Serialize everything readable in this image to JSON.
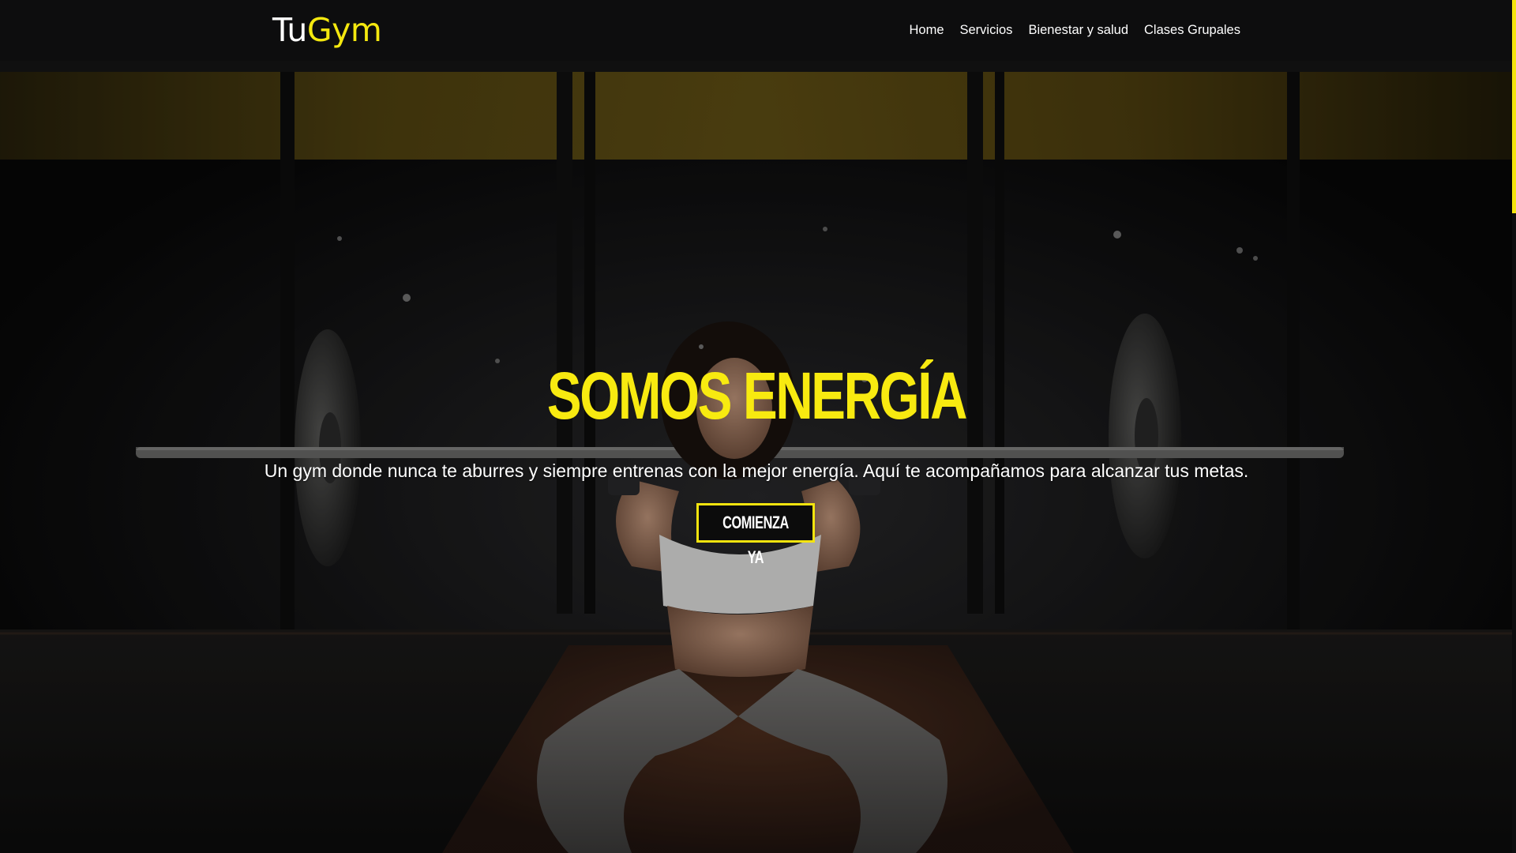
{
  "brand": {
    "part1": "Tu",
    "part2": "Gym"
  },
  "nav": {
    "items": [
      {
        "label": "Home"
      },
      {
        "label": "Servicios"
      },
      {
        "label": "Bienestar y salud"
      },
      {
        "label": "Clases Grupales"
      }
    ]
  },
  "hero": {
    "title": "SOMOS ENERGÍA",
    "subtitle": "Un gym donde nunca te aburres y siempre entrenas con la mejor energía. Aquí te acompañamos para alcanzar tus metas.",
    "cta_label": "COMIENZA YA"
  },
  "colors": {
    "accent": "#f4e80f",
    "navbar_bg": "#0d0d0e",
    "text": "#ffffff"
  },
  "icons": {
    "background": "gym-weightlifter-photo"
  }
}
